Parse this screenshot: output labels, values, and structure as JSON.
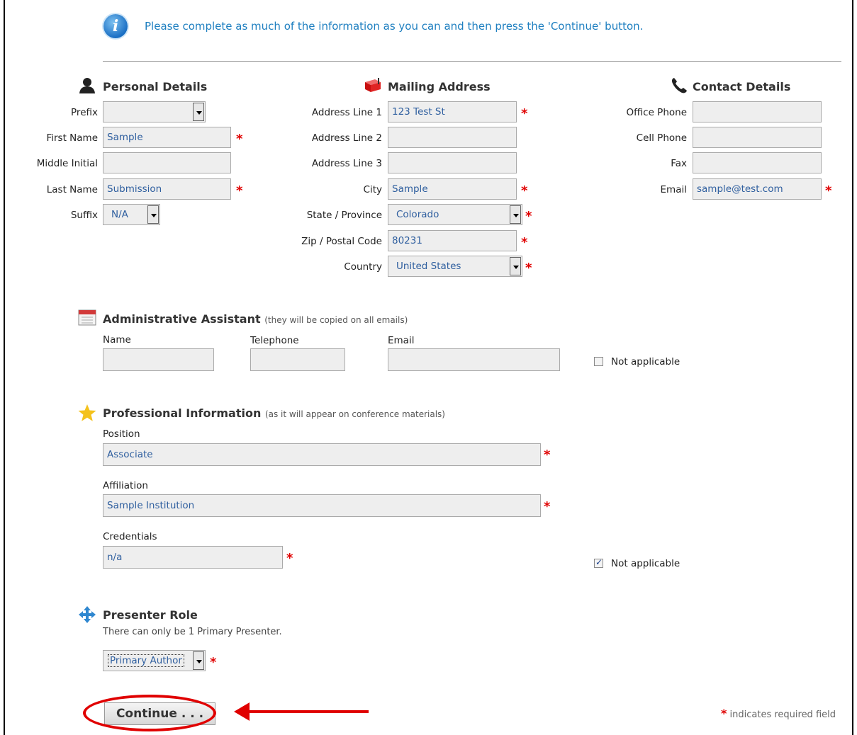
{
  "info": {
    "text": "Please complete as much of the information as you can and then press the 'Continue' button."
  },
  "personal": {
    "title": "Personal Details",
    "prefix": {
      "label": "Prefix",
      "value": ""
    },
    "first_name": {
      "label": "First Name",
      "value": "Sample"
    },
    "middle_initial": {
      "label": "Middle Initial",
      "value": ""
    },
    "last_name": {
      "label": "Last Name",
      "value": "Submission"
    },
    "suffix": {
      "label": "Suffix",
      "value": "N/A"
    }
  },
  "mailing": {
    "title": "Mailing Address",
    "line1": {
      "label": "Address Line 1",
      "value": "123 Test St"
    },
    "line2": {
      "label": "Address Line 2",
      "value": ""
    },
    "line3": {
      "label": "Address Line 3",
      "value": ""
    },
    "city": {
      "label": "City",
      "value": "Sample"
    },
    "state": {
      "label": "State / Province",
      "value": "Colorado"
    },
    "zip": {
      "label": "Zip / Postal Code",
      "value": "80231"
    },
    "country": {
      "label": "Country",
      "value": "United States"
    }
  },
  "contact": {
    "title": "Contact Details",
    "office": {
      "label": "Office Phone",
      "value": ""
    },
    "cell": {
      "label": "Cell Phone",
      "value": ""
    },
    "fax": {
      "label": "Fax",
      "value": ""
    },
    "email": {
      "label": "Email",
      "value": "sample@test.com"
    }
  },
  "assistant": {
    "title": "Administrative Assistant",
    "subtitle": "(they will be copied on all emails)",
    "name_label": "Name",
    "telephone_label": "Telephone",
    "email_label": "Email",
    "name_value": "",
    "telephone_value": "",
    "email_value": "",
    "not_applicable_label": "Not applicable",
    "not_applicable_checked": false
  },
  "professional": {
    "title": "Professional Information",
    "subtitle": "(as it will appear on conference materials)",
    "position_label": "Position",
    "position_value": "Associate",
    "affiliation_label": "Affiliation",
    "affiliation_value": "Sample Institution",
    "credentials_label": "Credentials",
    "credentials_value": "n/a",
    "not_applicable_label": "Not applicable",
    "not_applicable_checked": true
  },
  "presenter": {
    "title": "Presenter Role",
    "note": "There can only be 1 Primary Presenter.",
    "role_value": "Primary Author"
  },
  "required_marker": "*",
  "continue_label": "Continue . . .",
  "legend_text": "indicates required field",
  "colors": {
    "link_blue": "#1e7fc0",
    "required_red": "#e00000",
    "field_bg": "#eeeeee"
  },
  "icons": [
    "info-icon",
    "person-icon",
    "mailbox-icon",
    "phone-icon",
    "calendar-icon",
    "star-icon",
    "move-arrows-icon",
    "chevron-down-icon"
  ]
}
